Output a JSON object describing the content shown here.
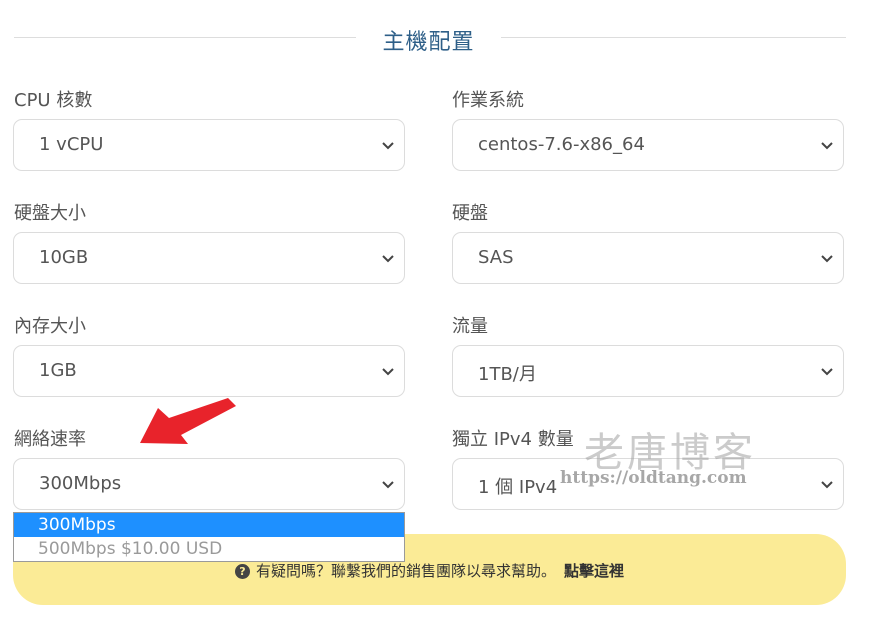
{
  "section_title": "主機配置",
  "fields": {
    "cpu": {
      "label": "CPU 核數",
      "value": "1 vCPU"
    },
    "os": {
      "label": "作業系統",
      "value": "centos-7.6-x86_64"
    },
    "disk_size": {
      "label": "硬盤大小",
      "value": "10GB"
    },
    "disk_type": {
      "label": "硬盤",
      "value": "SAS"
    },
    "memory": {
      "label": "內存大小",
      "value": "1GB"
    },
    "traffic": {
      "label": "流量",
      "value": "1TB/月"
    },
    "bandwidth": {
      "label": "網絡速率",
      "value": "300Mbps"
    },
    "ipv4": {
      "label": "獨立 IPv4 數量",
      "value": "1 個 IPv4"
    }
  },
  "bandwidth_dropdown": {
    "options": [
      "300Mbps",
      "500Mbps $10.00 USD"
    ],
    "selected": "300Mbps"
  },
  "help": {
    "icon": "question-circle-icon",
    "text": "有疑問嗎？聯繫我們的銷售團隊以尋求幫助。",
    "link": "點擊這裡"
  },
  "watermark": {
    "text": "老唐博客",
    "url": "https://oldtang.com"
  },
  "colors": {
    "title": "#2e5f88",
    "highlight": "#1e90ff",
    "help_bg": "#fbeb96",
    "arrow": "#e8232b"
  }
}
